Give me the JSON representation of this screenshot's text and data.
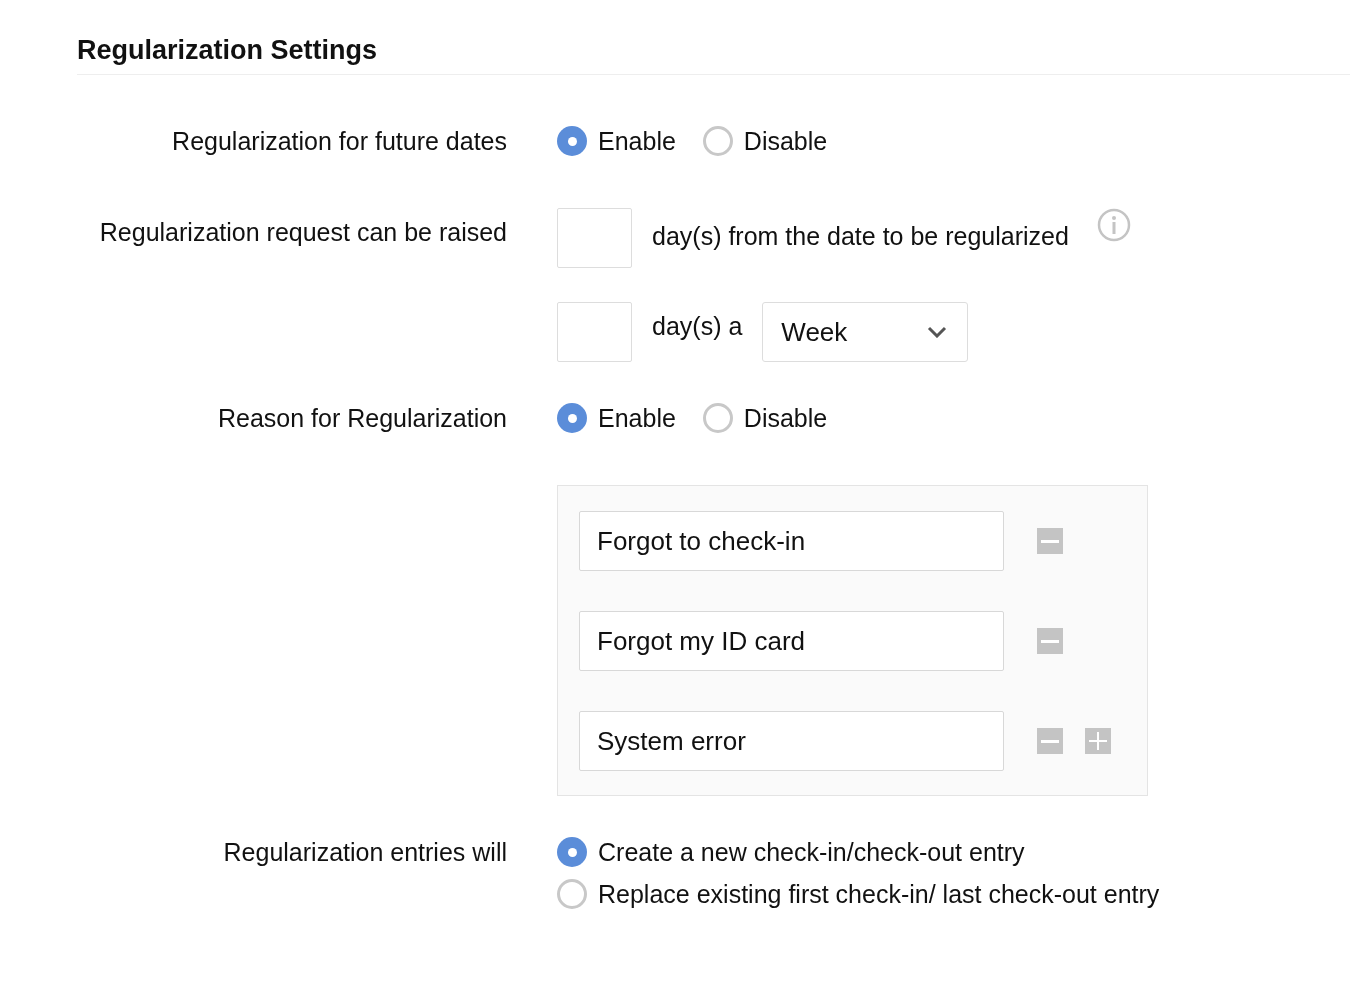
{
  "title": "Regularization Settings",
  "settings": [
    {
      "kind": "radio",
      "label": "Regularization for future dates",
      "options": [
        {
          "label": "Enable",
          "selected": true
        },
        {
          "label": "Disable",
          "selected": false
        }
      ]
    },
    {
      "kind": "days",
      "label": "Regularization request can be raised",
      "suffix": "day(s) from the date to be regularized"
    },
    {
      "kind": "limit",
      "suffix": "day(s) a",
      "period": "Week"
    },
    {
      "kind": "radio",
      "label": "Reason for Regularization",
      "options": [
        {
          "label": "Enable",
          "selected": true
        },
        {
          "label": "Disable",
          "selected": false
        }
      ]
    },
    {
      "kind": "reasons",
      "items": [
        {
          "value": "Forgot to check-in"
        },
        {
          "value": "Forgot my ID card"
        },
        {
          "value": "System error"
        }
      ]
    },
    {
      "kind": "radio-stack",
      "label": "Regularization entries will",
      "options": [
        {
          "label": "Create a new check-in/check-out entry",
          "selected": true
        },
        {
          "label": "Replace existing first check-in/ last check-out entry",
          "selected": false
        }
      ]
    }
  ]
}
